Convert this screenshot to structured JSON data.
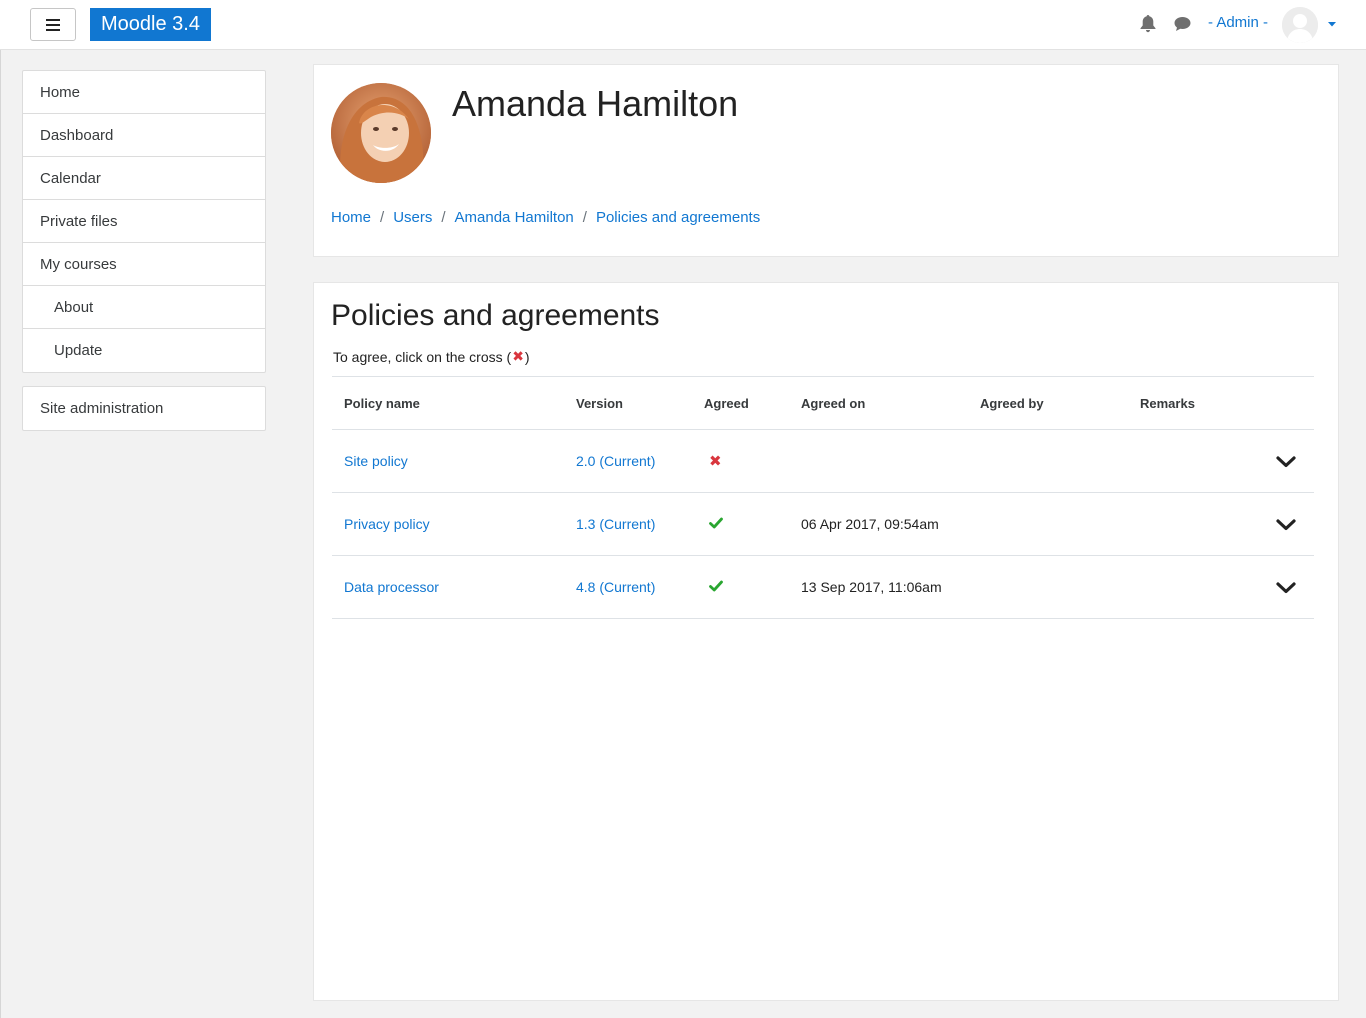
{
  "navbar": {
    "brand": "Moodle 3.4",
    "user_name": "- Admin -",
    "icons": [
      "hamburger-icon",
      "bell-icon",
      "chat-icon",
      "caret-down-icon"
    ]
  },
  "drawer": {
    "items": [
      {
        "label": "Home"
      },
      {
        "label": "Dashboard"
      },
      {
        "label": "Calendar"
      },
      {
        "label": "Private files"
      },
      {
        "label": "My courses"
      },
      {
        "label": "About"
      },
      {
        "label": "Update"
      }
    ],
    "admin_label": "Site administration"
  },
  "header": {
    "title": "Amanda Hamilton",
    "breadcrumb": [
      "Home",
      "Users",
      "Amanda Hamilton",
      "Policies and agreements"
    ],
    "separator": "/"
  },
  "content": {
    "title": "Policies and agreements",
    "instructions_before": "To agree, click on the cross (",
    "instructions_mark": "✖",
    "instructions_after": ")",
    "columns": [
      "Policy name",
      "Version",
      "Agreed",
      "Agreed on",
      "Agreed by",
      "Remarks"
    ],
    "rows": [
      {
        "name": "Site policy",
        "version": "2.0 (Current)",
        "agreed": false,
        "agreed_mark": "✖",
        "agreed_on": "",
        "agreed_by": "",
        "remarks": ""
      },
      {
        "name": "Privacy policy",
        "version": "1.3 (Current)",
        "agreed": true,
        "agreed_on": "06 Apr 2017, 09:54am",
        "agreed_by": "",
        "remarks": ""
      },
      {
        "name": "Data processor",
        "version": "4.8 (Current)",
        "agreed": true,
        "agreed_on": "13 Sep 2017, 11:06am",
        "agreed_by": "",
        "remarks": ""
      }
    ]
  },
  "colors": {
    "brand": "#1177d1",
    "link": "#1177d1",
    "cross": "#d9363e",
    "check": "#2aa631"
  }
}
